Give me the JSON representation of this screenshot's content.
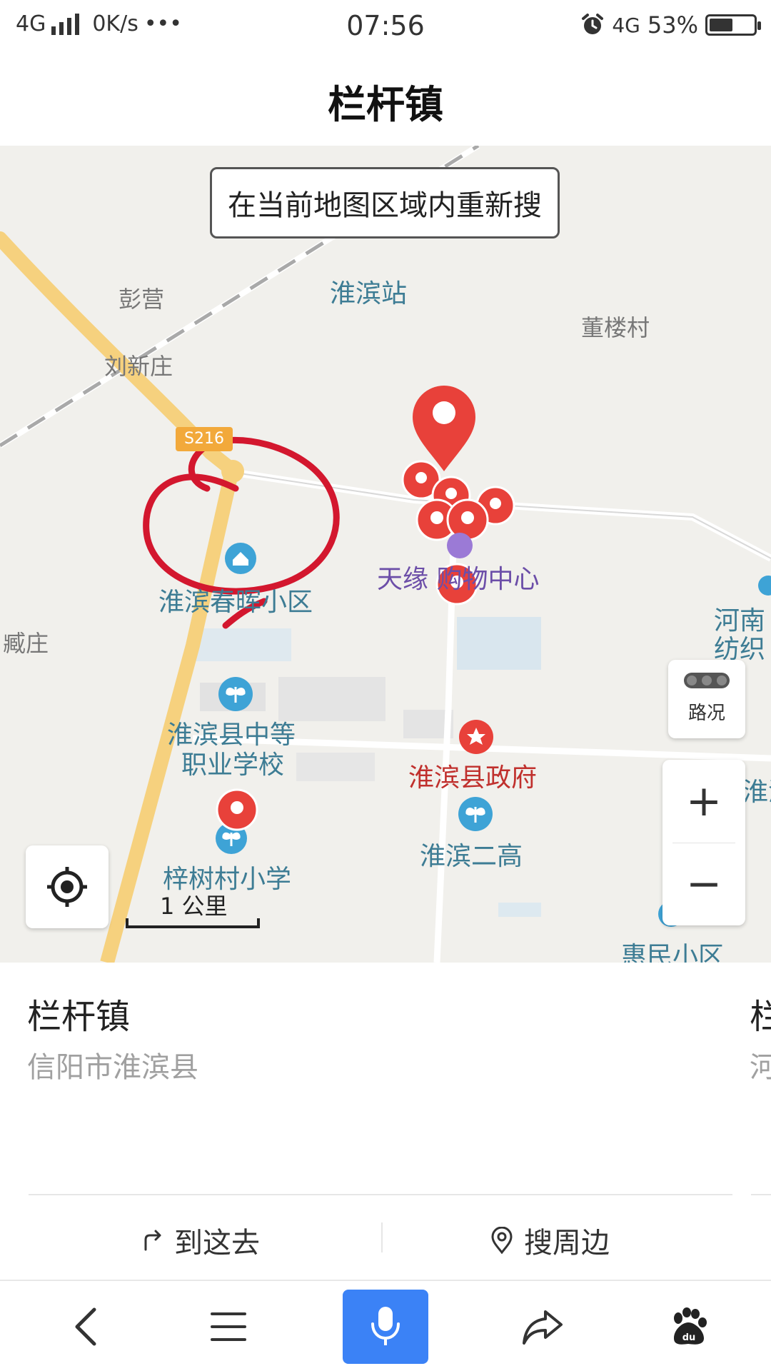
{
  "status_bar": {
    "network": "4G",
    "speed": "0K/s",
    "dots": "•••",
    "time": "07:56",
    "network_right": "4G",
    "battery_text": "53%",
    "battery_level": 0.53,
    "alarm_icon": "alarm-clock-icon"
  },
  "header": {
    "title": "栏杆镇"
  },
  "map": {
    "research_button": "在当前地图区域内重新搜",
    "road_badge": "S216",
    "labels": {
      "huaibin_station": "淮滨站",
      "pengying": "彭营",
      "liuxinzhuang": "刘新庄",
      "donglou": "董楼村",
      "tianyuan": "天缘 购物中心",
      "chunhui": "淮滨春晖小区",
      "zangzhuang": "臧庄",
      "henan_textile": "河南 纺织",
      "vocational_school_1": "淮滨县中等",
      "vocational_school_2": "职业学校",
      "county_gov": "淮滨县政府",
      "zishu_school": "梓树村小学",
      "huaibin_no2": "淮滨二高",
      "huimin": "惠民小区",
      "huai_edge": "淮滨"
    },
    "traffic_label": "路况",
    "zoom_in": "+",
    "zoom_out": "−",
    "scale_label": "1 公里",
    "accent_red": "#e8413a",
    "annotation_color": "#d3172e"
  },
  "card": {
    "name": "栏杆镇",
    "address": "信阳市淮滨县",
    "peek_name": "栏",
    "peek_address": "河",
    "go_label": "到这去",
    "nearby_label": "搜周边"
  },
  "bottom_nav": {
    "accent": "#3b82f6",
    "icons": [
      "back-icon",
      "menu-icon",
      "microphone-icon",
      "share-icon",
      "baidu-paw-icon"
    ]
  }
}
